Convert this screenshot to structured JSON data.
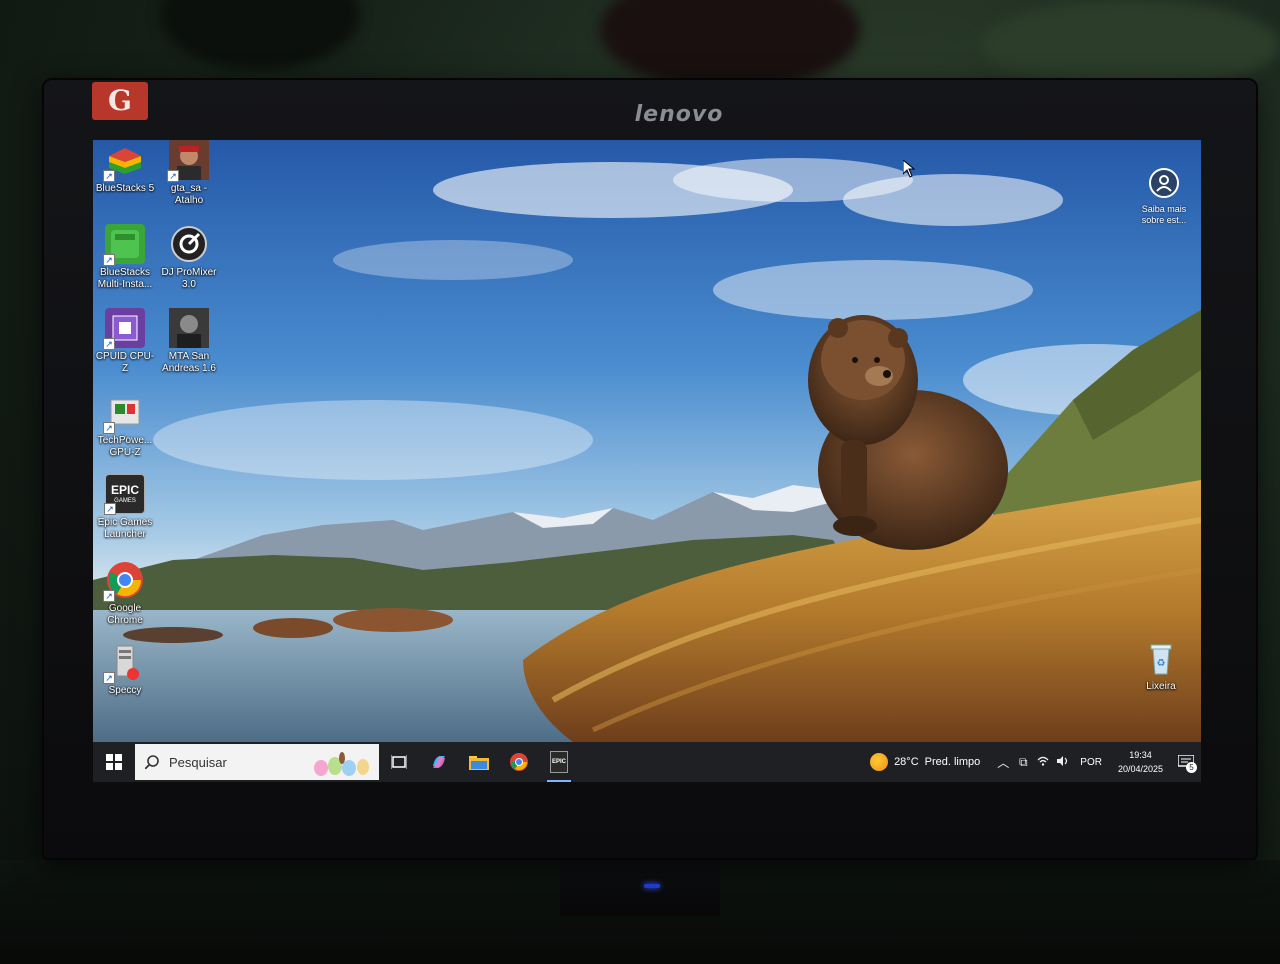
{
  "monitor": {
    "brand": "lenovo",
    "sticker": "G"
  },
  "desktop": {
    "icons": [
      {
        "label": "BlueStacks 5",
        "icon": "bluestacks-icon"
      },
      {
        "label": "gta_sa - Atalho",
        "icon": "gta-sa-icon"
      },
      {
        "label": "BlueStacks Multi-Insta...",
        "icon": "bluestacks-multi-instance-icon"
      },
      {
        "label": "DJ ProMixer 3.0",
        "icon": "dj-promixer-icon"
      },
      {
        "label": "CPUID CPU-Z",
        "icon": "cpu-z-icon"
      },
      {
        "label": "MTA San Andreas 1.6",
        "icon": "mta-san-andreas-icon"
      },
      {
        "label": "TechPowe... GPU-Z",
        "icon": "gpu-z-icon"
      },
      {
        "label": "Epic Games Launcher",
        "icon": "epic-games-icon",
        "glyph_top": "EPIC",
        "glyph_bottom": "GAMES"
      },
      {
        "label": "Google Chrome",
        "icon": "chrome-icon"
      },
      {
        "label": "Speccy",
        "icon": "speccy-icon"
      },
      {
        "label": "Lixeira",
        "icon": "recycle-bin-icon"
      }
    ],
    "widget": {
      "label": "Saiba mais sobre est...",
      "icon": "learn-more-icon"
    }
  },
  "taskbar": {
    "search_placeholder": "Pesquisar",
    "apps": [
      {
        "name": "task-view",
        "icon": "task-view-icon"
      },
      {
        "name": "copilot",
        "icon": "copilot-icon"
      },
      {
        "name": "file-explorer",
        "icon": "folder-icon"
      },
      {
        "name": "chrome",
        "icon": "chrome-icon"
      },
      {
        "name": "epic-games",
        "icon": "epic-games-icon",
        "glyph": "EPIC"
      }
    ],
    "weather": {
      "temp": "28°C",
      "condition": "Pred. limpo"
    },
    "tray": {
      "language": "POR",
      "time": "19:34",
      "date": "20/04/2025",
      "notifications": "5"
    }
  },
  "colors": {
    "taskbar_bg": "#1e2024",
    "chrome_red": "#db4437",
    "chrome_green": "#0f9d58",
    "chrome_yellow": "#f4b400",
    "chrome_blue": "#4285f4"
  }
}
